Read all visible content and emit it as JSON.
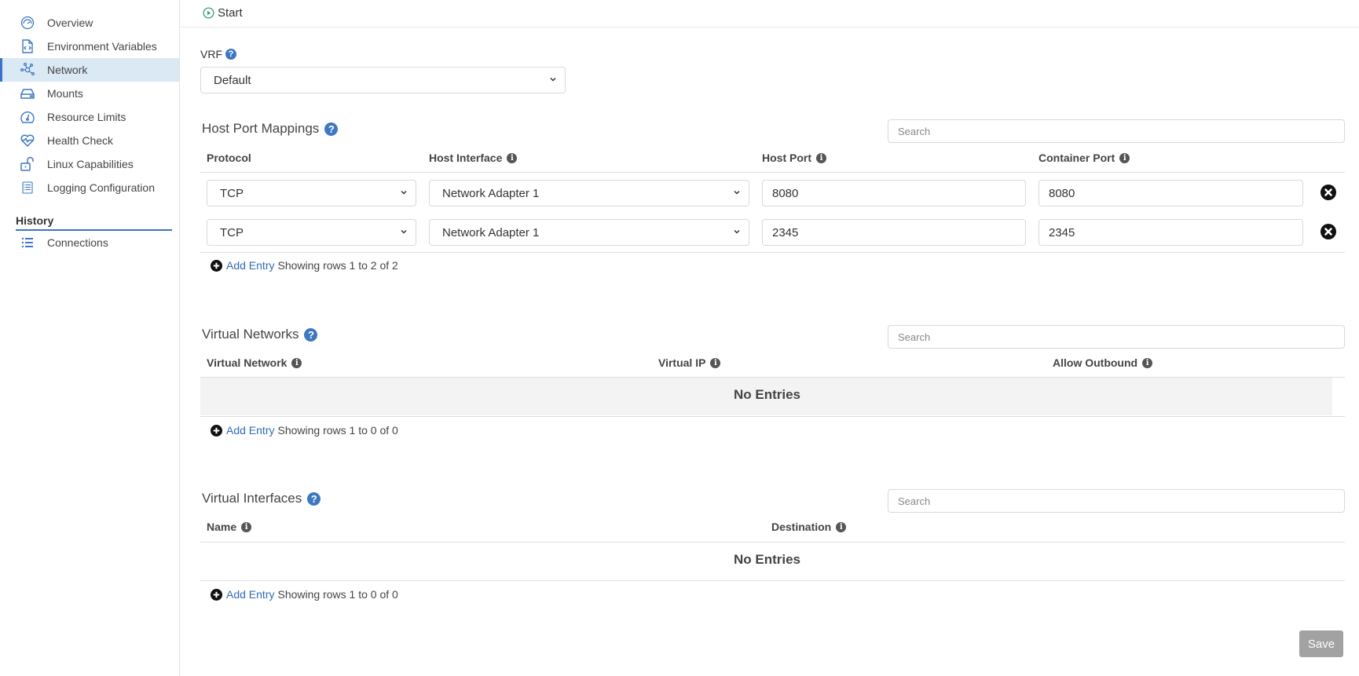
{
  "sidebar": {
    "items": [
      {
        "label": "Overview",
        "icon": "dashboard-gauge-icon"
      },
      {
        "label": "Environment Variables",
        "icon": "code-file-icon"
      },
      {
        "label": "Network",
        "icon": "network-nodes-icon",
        "active": true
      },
      {
        "label": "Mounts",
        "icon": "drive-icon"
      },
      {
        "label": "Resource Limits",
        "icon": "gauge-icon"
      },
      {
        "label": "Health Check",
        "icon": "heartbeat-icon"
      },
      {
        "label": "Linux Capabilities",
        "icon": "unlock-icon"
      },
      {
        "label": "Logging Configuration",
        "icon": "log-list-icon"
      }
    ],
    "history": {
      "heading": "History",
      "items": [
        {
          "label": "Connections",
          "icon": "list-icon"
        }
      ]
    }
  },
  "topbar": {
    "start_label": "Start"
  },
  "vrf": {
    "label": "VRF",
    "selected": "Default"
  },
  "host_port_mappings": {
    "title": "Host Port Mappings",
    "search_placeholder": "Search",
    "columns": [
      "Protocol",
      "Host Interface",
      "Host Port",
      "Container Port"
    ],
    "rows": [
      {
        "protocol": "TCP",
        "host_interface": "Network Adapter 1",
        "host_port": "8080",
        "container_port": "8080"
      },
      {
        "protocol": "TCP",
        "host_interface": "Network Adapter 1",
        "host_port": "2345",
        "container_port": "2345"
      }
    ],
    "add_entry": "Add Entry",
    "status": "Showing rows 1 to 2 of 2"
  },
  "virtual_networks": {
    "title": "Virtual Networks",
    "search_placeholder": "Search",
    "columns": [
      "Virtual Network",
      "Virtual IP",
      "Allow Outbound"
    ],
    "empty_text": "No Entries",
    "add_entry": "Add Entry",
    "status": "Showing rows 1 to 0 of 0"
  },
  "virtual_interfaces": {
    "title": "Virtual Interfaces",
    "search_placeholder": "Search",
    "columns": [
      "Name",
      "Destination"
    ],
    "empty_text": "No Entries",
    "add_entry": "Add Entry",
    "status": "Showing rows 1 to 0 of 0"
  },
  "actions": {
    "save_label": "Save"
  },
  "colors": {
    "accent": "#3b73c8",
    "active_bg": "#dbe9f5",
    "link": "#2f6cb5",
    "start_icon": "#3aa07a",
    "save_disabled": "#a2a2a2"
  }
}
